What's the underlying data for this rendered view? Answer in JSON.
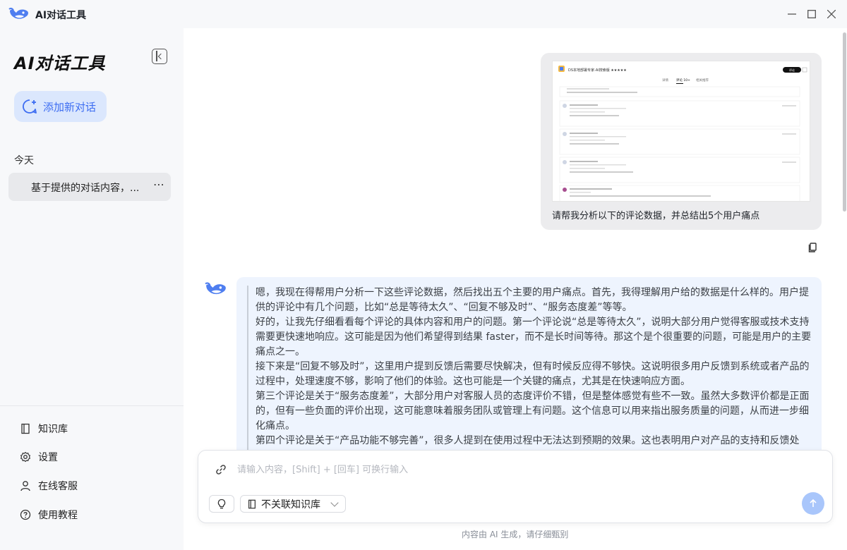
{
  "titlebar": {
    "app_title": "AI对话工具",
    "minimize_icon": "minimize-icon",
    "maximize_icon": "maximize-icon",
    "close_icon": "close-icon"
  },
  "sidebar": {
    "brand": "AI对话工具",
    "new_chat_label": "添加新对话",
    "section_today": "今天",
    "conversations": [
      {
        "label": "基于提供的对话内容，...",
        "more": "⋯"
      }
    ],
    "nav": [
      {
        "label": "知识库",
        "icon": "book-icon"
      },
      {
        "label": "设置",
        "icon": "gear-icon"
      },
      {
        "label": "在线客服",
        "icon": "user-icon"
      },
      {
        "label": "使用教程",
        "icon": "help-circle-icon"
      }
    ]
  },
  "chat": {
    "user_message": {
      "text": "请帮我分析以下的评论数据，并总结出5个用户痛点",
      "attachment": {
        "title": "DS本地部署专家-AI搜索版 ★★★★★",
        "top_button": "评论",
        "tabs": [
          "详情",
          "评论 10+",
          "相关推荐"
        ]
      }
    },
    "ai_message": {
      "paragraphs": [
        "嗯，我现在得帮用户分析一下这些评论数据，然后找出五个主要的用户痛点。首先，我得理解用户给的数据是什么样的。用户提供的评论中有几个问题，比如“总是等待太久”、“回复不够及时”、“服务态度差”等等。",
        "好的，让我先仔细看看每个评论的具体内容和用户的问题。第一个评论说“总是等待太久”，说明大部分用户觉得客服或技术支持需要更快速地响应。这可能是因为他们希望得到结果 faster，而不是长时间等待。那这个是个很重要的问题，可能是用户的主要痛点之一。",
        "接下来是“回复不够及时”，这里用户提到反馈后需要尽快解决，但有时候反应得不够快。这说明很多用户反馈到系统或者产品的过程中，处理速度不够，影响了他们的体验。这也可能是一个关键的痛点，尤其是在快速响应方面。",
        "第三个评论是关于“服务态度差”，大部分用户对客服人员的态度评价不错，但是整体感觉有些不一致。虽然大多数评价都是正面的，但有一些负面的评价出现，这可能意味着服务团队或管理上有问题。这个信息可以用来指出服务质量的问题，从而进一步细化痛点。",
        "第四个评论是关于“产品功能不够完善”，很多人提到在使用过程中无法达到预期的效果。这也表明用户对产品的支持和反馈处"
      ]
    }
  },
  "composer": {
    "placeholder": "请输入内容，[Shift] + [回车] 可换行输入",
    "knowledge_select": "不关联知识库",
    "footer_note": "内容由 AI 生成，请仔细甄别"
  },
  "colors": {
    "accent": "#3d6df2",
    "new_chat_bg": "#dbe7fd",
    "ai_bubble_bg": "#eef4fe",
    "user_bubble_bg": "#ececee",
    "send_button": "#a9c6fb"
  }
}
